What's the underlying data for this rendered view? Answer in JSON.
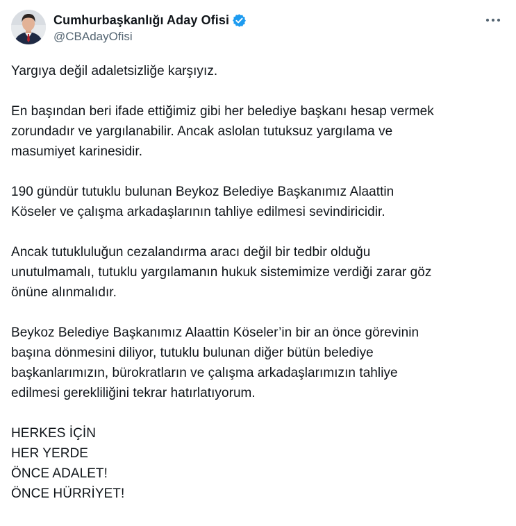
{
  "author": {
    "display_name": "Cumhurbaşkanlığı Aday Ofisi",
    "handle": "@CBAdayOfisi",
    "verified": true,
    "verified_color": "#1d9bf0",
    "avatar_icon": "profile-photo"
  },
  "menu": {
    "icon": "more-horizontal-icon"
  },
  "tweet": {
    "paragraphs": [
      "Yargıya değil adaletsizliğe karşıyız.",
      "En başından beri ifade ettiğimiz gibi her belediye başkanı hesap vermek\nzorundadır ve yargılanabilir. Ancak aslolan tutuksuz yargılama ve\nmasumiyet karinesidir.",
      "190 gündür tutuklu bulunan Beykoz Belediye Başkanımız Alaattin\nKöseler ve çalışma arkadaşlarının tahliye edilmesi sevindiricidir.",
      "Ancak tutukluluğun cezalandırma aracı değil bir tedbir olduğu\nunutulmamalı, tutuklu yargılamanın hukuk sistemimize verdiği zarar göz\nönüne alınmalıdır.",
      "Beykoz Belediye Başkanımız Alaattin Köseler’in bir an önce görevinin\nbaşına dönmesini diliyor, tutuklu bulunan diğer bütün belediye\nbaşkanlarımızın, bürokratların ve çalışma arkadaşlarımızın tahliye\nedilmesi gerekliliğini tekrar hatırlatıyorum.",
      "HERKES İÇİN\nHER YERDE\nÖNCE ADALET!\nÖNCE HÜRRİYET!"
    ]
  }
}
